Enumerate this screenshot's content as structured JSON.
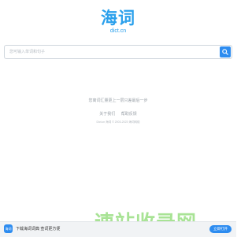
{
  "logo": {
    "mark": "海词",
    "domain": "dict.cn"
  },
  "search": {
    "placeholder": "您可输入单词和句子",
    "value": ""
  },
  "tagline": "您离词汇量更上一层只差最后一步",
  "links": [
    "关于我们",
    "帮助反馈"
  ],
  "copyright": "Dict.cn 海词 © 2003-2023 海词网络",
  "watermark": "速站收录网",
  "bottom_bar": {
    "app_label": "海词",
    "promo": "下载海词词典 查词更方便",
    "open_button": "立即打开"
  },
  "colors": {
    "accent": "#2aa0ec",
    "button": "#2d8cf0",
    "watermark": "#9fe08a"
  }
}
